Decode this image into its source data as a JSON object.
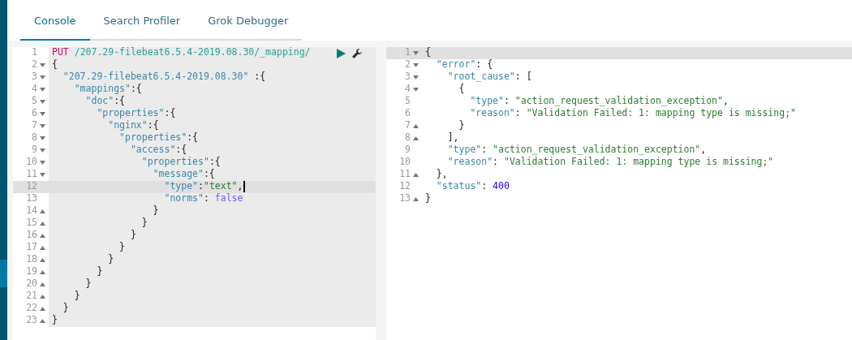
{
  "tabs": [
    {
      "label": "Console",
      "selected": true
    },
    {
      "label": "Search Profiler",
      "selected": false
    },
    {
      "label": "Grok Debugger",
      "selected": false
    }
  ],
  "request": {
    "lines": [
      {
        "number": "1",
        "tokens": [
          {
            "kind": "method",
            "text": "PUT"
          },
          {
            "kind": "url",
            "text": " /207.29-filebeat6.5.4-2019.08.30/_mapping/"
          }
        ]
      },
      {
        "number": "2",
        "fold_start": true,
        "tokens": [
          {
            "kind": "punct",
            "text": "{"
          }
        ]
      },
      {
        "number": "3",
        "fold_start": true,
        "tokens": [
          {
            "kind": "key",
            "text": "  \"207.29-filebeat6.5.4-2019.08.30\""
          },
          {
            "kind": "punct",
            "text": " :{"
          }
        ]
      },
      {
        "number": "4",
        "fold_start": true,
        "tokens": [
          {
            "kind": "key",
            "text": "    \"mappings\""
          },
          {
            "kind": "punct",
            "text": ":{"
          }
        ]
      },
      {
        "number": "5",
        "fold_start": true,
        "tokens": [
          {
            "kind": "key",
            "text": "      \"doc\""
          },
          {
            "kind": "punct",
            "text": ":{"
          }
        ]
      },
      {
        "number": "6",
        "fold_start": true,
        "tokens": [
          {
            "kind": "key",
            "text": "        \"properties\""
          },
          {
            "kind": "punct",
            "text": ":{"
          }
        ]
      },
      {
        "number": "7",
        "fold_start": true,
        "tokens": [
          {
            "kind": "key",
            "text": "          \"nginx\""
          },
          {
            "kind": "punct",
            "text": ":{"
          }
        ]
      },
      {
        "number": "8",
        "fold_start": true,
        "tokens": [
          {
            "kind": "key",
            "text": "            \"properties\""
          },
          {
            "kind": "punct",
            "text": ":{"
          }
        ]
      },
      {
        "number": "9",
        "fold_start": true,
        "tokens": [
          {
            "kind": "key",
            "text": "              \"access\""
          },
          {
            "kind": "punct",
            "text": ":{"
          }
        ]
      },
      {
        "number": "10",
        "fold_start": true,
        "tokens": [
          {
            "kind": "key",
            "text": "                \"properties\""
          },
          {
            "kind": "punct",
            "text": ":{"
          }
        ]
      },
      {
        "number": "11",
        "fold_start": true,
        "tokens": [
          {
            "kind": "key",
            "text": "                  \"message\""
          },
          {
            "kind": "punct",
            "text": ":{"
          }
        ]
      },
      {
        "number": "12",
        "active": true,
        "cursor": true,
        "tokens": [
          {
            "kind": "key",
            "text": "                    \"type\""
          },
          {
            "kind": "punct",
            "text": ":"
          },
          {
            "kind": "string",
            "text": "\"text\""
          },
          {
            "kind": "punct",
            "text": ","
          }
        ]
      },
      {
        "number": "13",
        "tokens": [
          {
            "kind": "key",
            "text": "                    \"norms\""
          },
          {
            "kind": "punct",
            "text": ": "
          },
          {
            "kind": "boolean",
            "text": "false"
          }
        ]
      },
      {
        "number": "14",
        "fold_end": true,
        "tokens": [
          {
            "kind": "punct",
            "text": "                  }"
          }
        ]
      },
      {
        "number": "15",
        "fold_end": true,
        "tokens": [
          {
            "kind": "punct",
            "text": "                }"
          }
        ]
      },
      {
        "number": "16",
        "fold_end": true,
        "tokens": [
          {
            "kind": "punct",
            "text": "              }"
          }
        ]
      },
      {
        "number": "17",
        "fold_end": true,
        "tokens": [
          {
            "kind": "punct",
            "text": "            }"
          }
        ]
      },
      {
        "number": "18",
        "fold_end": true,
        "tokens": [
          {
            "kind": "punct",
            "text": "          }"
          }
        ]
      },
      {
        "number": "19",
        "fold_end": true,
        "tokens": [
          {
            "kind": "punct",
            "text": "        }"
          }
        ]
      },
      {
        "number": "20",
        "fold_end": true,
        "tokens": [
          {
            "kind": "punct",
            "text": "      }"
          }
        ]
      },
      {
        "number": "21",
        "fold_end": true,
        "tokens": [
          {
            "kind": "punct",
            "text": "    }"
          }
        ]
      },
      {
        "number": "22",
        "fold_end": true,
        "tokens": [
          {
            "kind": "punct",
            "text": "  }"
          }
        ]
      },
      {
        "number": "23",
        "fold_end": true,
        "tokens": [
          {
            "kind": "punct",
            "text": "}"
          }
        ]
      }
    ]
  },
  "response": {
    "lines": [
      {
        "number": "1",
        "fold_start": true,
        "active": true,
        "tokens": [
          {
            "kind": "punct",
            "text": "{"
          }
        ]
      },
      {
        "number": "2",
        "fold_start": true,
        "tokens": [
          {
            "kind": "key",
            "text": "  \"error\""
          },
          {
            "kind": "punct",
            "text": ": {"
          }
        ]
      },
      {
        "number": "3",
        "fold_start": true,
        "tokens": [
          {
            "kind": "key",
            "text": "    \"root_cause\""
          },
          {
            "kind": "punct",
            "text": ": ["
          }
        ]
      },
      {
        "number": "4",
        "fold_start": true,
        "tokens": [
          {
            "kind": "punct",
            "text": "      {"
          }
        ]
      },
      {
        "number": "5",
        "tokens": [
          {
            "kind": "key",
            "text": "        \"type\""
          },
          {
            "kind": "punct",
            "text": ": "
          },
          {
            "kind": "string",
            "text": "\"action_request_validation_exception\""
          },
          {
            "kind": "punct",
            "text": ","
          }
        ]
      },
      {
        "number": "6",
        "tokens": [
          {
            "kind": "key",
            "text": "        \"reason\""
          },
          {
            "kind": "punct",
            "text": ": "
          },
          {
            "kind": "string",
            "text": "\"Validation Failed: 1: mapping type is missing;\""
          }
        ]
      },
      {
        "number": "7",
        "fold_end": true,
        "tokens": [
          {
            "kind": "punct",
            "text": "      }"
          }
        ]
      },
      {
        "number": "8",
        "fold_end": true,
        "tokens": [
          {
            "kind": "punct",
            "text": "    ],"
          }
        ]
      },
      {
        "number": "9",
        "tokens": [
          {
            "kind": "key",
            "text": "    \"type\""
          },
          {
            "kind": "punct",
            "text": ": "
          },
          {
            "kind": "string",
            "text": "\"action_request_validation_exception\""
          },
          {
            "kind": "punct",
            "text": ","
          }
        ]
      },
      {
        "number": "10",
        "tokens": [
          {
            "kind": "key",
            "text": "    \"reason\""
          },
          {
            "kind": "punct",
            "text": ": "
          },
          {
            "kind": "string",
            "text": "\"Validation Failed: 1: mapping type is missing;\""
          }
        ]
      },
      {
        "number": "11",
        "fold_end": true,
        "tokens": [
          {
            "kind": "punct",
            "text": "  },"
          }
        ]
      },
      {
        "number": "12",
        "tokens": [
          {
            "kind": "key",
            "text": "  \"status\""
          },
          {
            "kind": "punct",
            "text": ": "
          },
          {
            "kind": "number",
            "text": "400"
          }
        ]
      },
      {
        "number": "13",
        "fold_end": true,
        "tokens": [
          {
            "kind": "punct",
            "text": "}"
          }
        ]
      }
    ]
  }
}
